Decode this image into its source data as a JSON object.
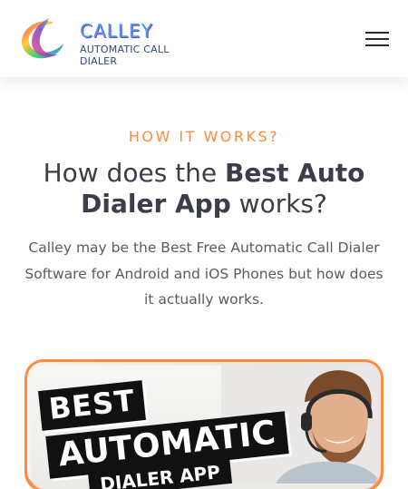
{
  "header": {
    "brand_name": "CALLEY",
    "brand_tagline": "AUTOMATIC CALL DIALER",
    "menu_icon": "hamburger-menu-icon"
  },
  "section": {
    "eyebrow": "HOW IT WORKS?",
    "headline_prefix": "How does the ",
    "headline_strong": "Best Auto Dialer App",
    "headline_suffix": " works?",
    "description": "Calley may be the Best Free Automatic Call Dialer Software for Android and iOS Phones but how does it actually works."
  },
  "hero_image": {
    "line1": "BEST",
    "line2": "AUTOMATIC",
    "line3": "DIALER APP"
  },
  "colors": {
    "accent": "#ff8a3d",
    "heading": "#3a3d4a",
    "body_text": "#555b66",
    "brand_blue": "#4a9ee8"
  }
}
